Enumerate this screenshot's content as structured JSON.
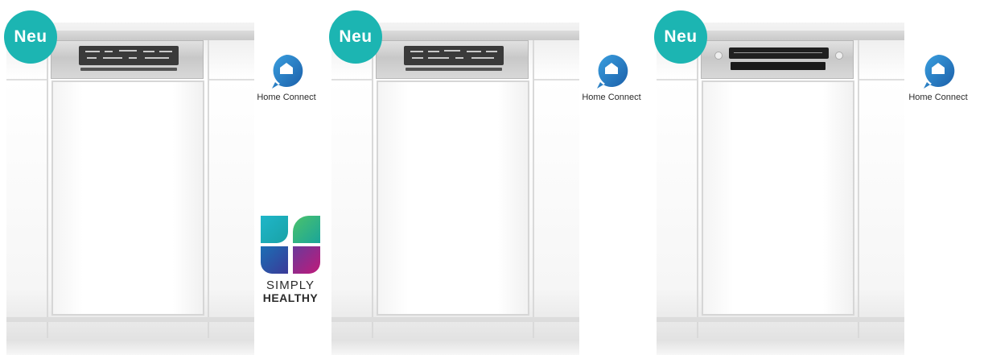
{
  "products": [
    {
      "badge": "Neu",
      "home_connect_label": "Home Connect",
      "simply_healthy": {
        "line1": "SIMPLY",
        "line2": "HEALTHY"
      }
    },
    {
      "badge": "Neu",
      "home_connect_label": "Home Connect"
    },
    {
      "badge": "Neu",
      "home_connect_label": "Home Connect"
    }
  ],
  "colors": {
    "badge": "#1cb5b2",
    "home_connect_blue": "#1c6fb8"
  },
  "icons": [
    "home-connect-icon",
    "simply-healthy-logo"
  ]
}
